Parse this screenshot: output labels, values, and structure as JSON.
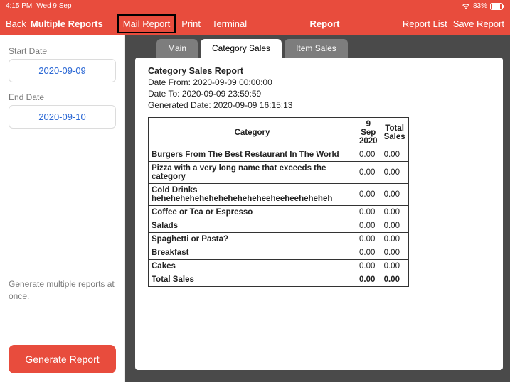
{
  "status": {
    "time": "4:15 PM",
    "date": "Wed 9 Sep",
    "battery": "83%"
  },
  "nav": {
    "back": "Back",
    "title": "Multiple Reports",
    "mail": "Mail Report",
    "print": "Print",
    "terminal": "Terminal",
    "center": "Report",
    "list": "Report List",
    "save": "Save Report"
  },
  "sidebar": {
    "start_label": "Start Date",
    "start_value": "2020-09-09",
    "end_label": "End Date",
    "end_value": "2020-09-10",
    "hint": "Generate multiple reports at once.",
    "generate": "Generate Report"
  },
  "tabs": {
    "main": "Main",
    "category": "Category Sales",
    "item": "Item Sales"
  },
  "report": {
    "title": "Category Sales Report",
    "from": "Date From: 2020-09-09 00:00:00",
    "to": "Date To: 2020-09-09 23:59:59",
    "generated": "Generated Date: 2020-09-09 16:15:13",
    "col_category": "Category",
    "col_date": "9 Sep 2020",
    "col_total": "Total Sales",
    "rows": [
      {
        "cat": "Burgers From The Best Restaurant In The World",
        "v": "0.00",
        "t": "0.00"
      },
      {
        "cat": "Pizza with a very long name that exceeds the category",
        "v": "0.00",
        "t": "0.00"
      },
      {
        "cat": "Cold Drinks heheheheheheheheheheheheeheeheeheheheh",
        "v": "0.00",
        "t": "0.00"
      },
      {
        "cat": "Coffee or Tea or Espresso",
        "v": "0.00",
        "t": "0.00"
      },
      {
        "cat": "Salads",
        "v": "0.00",
        "t": "0.00"
      },
      {
        "cat": "Spaghetti or Pasta?",
        "v": "0.00",
        "t": "0.00"
      },
      {
        "cat": "Breakfast",
        "v": "0.00",
        "t": "0.00"
      },
      {
        "cat": "Cakes",
        "v": "0.00",
        "t": "0.00"
      }
    ],
    "total_label": "Total Sales",
    "total_v": "0.00",
    "total_t": "0.00"
  }
}
